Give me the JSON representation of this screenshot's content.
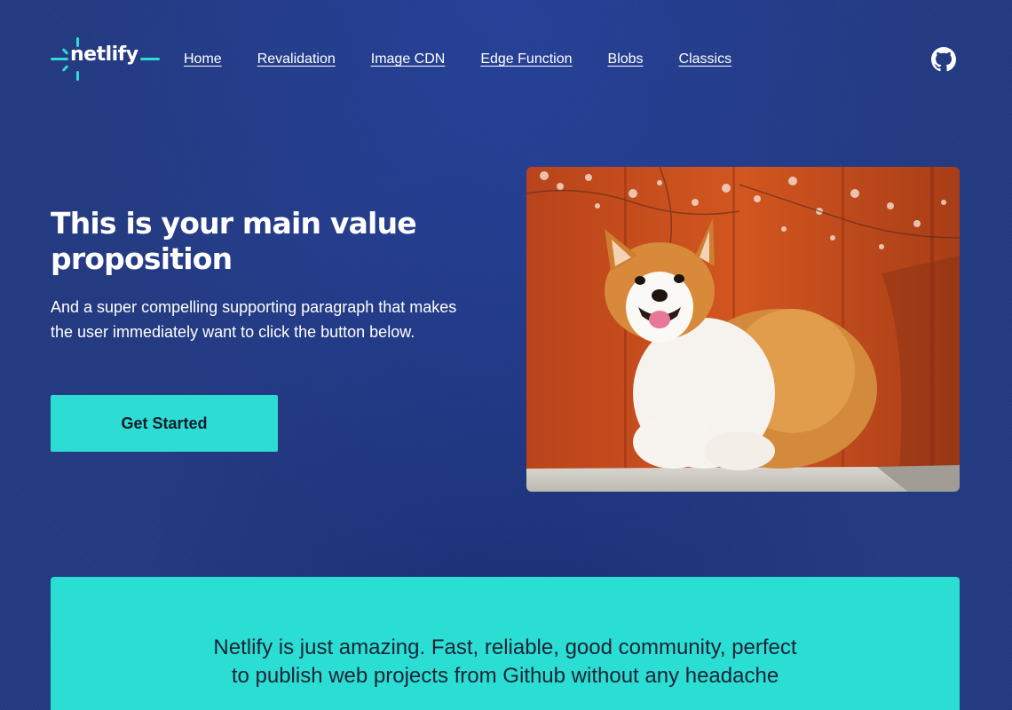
{
  "brand": {
    "name": "netlify",
    "accent_color": "#2ddcd2",
    "background_color": "#233a82"
  },
  "nav": {
    "items": [
      {
        "label": "Home"
      },
      {
        "label": "Revalidation"
      },
      {
        "label": "Image CDN"
      },
      {
        "label": "Edge Function"
      },
      {
        "label": "Blobs"
      },
      {
        "label": "Classics"
      }
    ],
    "github_icon": "github-icon"
  },
  "hero": {
    "title": "This is your main value proposition",
    "paragraph": "And a super compelling supporting paragraph that makes the user immediately want to click the button below.",
    "cta_label": "Get Started",
    "image_subject": "corgi"
  },
  "testimonial": {
    "quote": "Netlify is just amazing. Fast, reliable, good community, perfect to publish web projects from Github without any headache"
  }
}
